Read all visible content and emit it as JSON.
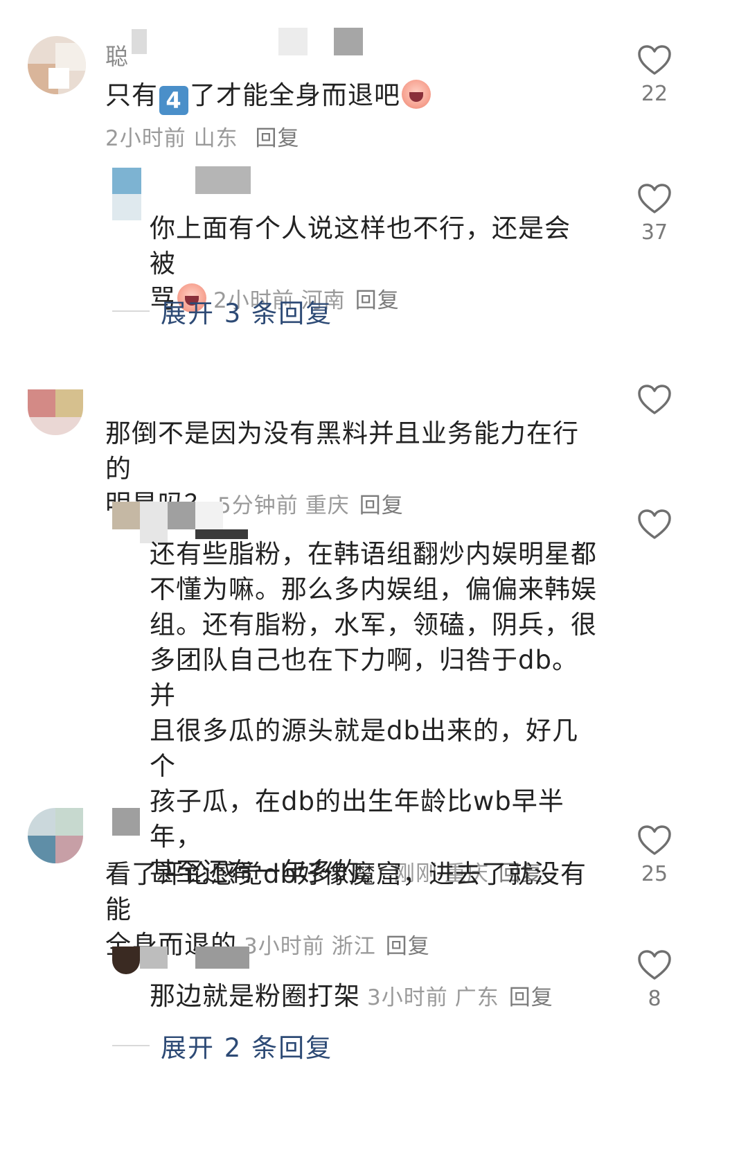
{
  "comments": [
    {
      "username": "聪",
      "text_before": "只有",
      "badge": "4",
      "text_after": "了才能全身而退吧",
      "time": "2小时前",
      "location": "山东",
      "reply": "回复",
      "likes": "22"
    },
    {
      "text": "你上面有个人说这样也不行，还是会被",
      "text2": "骂",
      "time": "2小时前",
      "location": "河南",
      "reply": "回复",
      "likes": "37"
    },
    {
      "text": "那倒不是因为没有黑料并且业务能力在行的",
      "text2": "明星吗？",
      "time": "5分钟前",
      "location": "重庆",
      "reply": "回复"
    },
    {
      "lines": [
        "还有些脂粉，在韩语组翻炒内娱明星都",
        "不懂为嘛。那么多内娱组，偏偏来韩娱",
        "组。还有脂粉，水军，领磕，阴兵，很",
        "多团队自己也在下力啊，归咎于db。并",
        "且很多瓜的源头就是db出来的，好几个",
        "孩子瓜，在db的出生年龄比wb早半年，",
        "甚至还有一年多的。"
      ],
      "time": "刚刚",
      "location": "重庆",
      "reply": "回复"
    },
    {
      "text": "看了评论感觉db好像魔窟，进去了就没有能",
      "text2": "全身而退的",
      "time": "3小时前",
      "location": "浙江",
      "reply": "回复",
      "likes": "25"
    },
    {
      "text": "那边就是粉圈打架",
      "time": "3小时前",
      "location": "广东",
      "reply": "回复",
      "likes": "8"
    }
  ],
  "expand": [
    {
      "label": "展开 3 条回复"
    },
    {
      "label": "展开 2 条回复"
    }
  ]
}
